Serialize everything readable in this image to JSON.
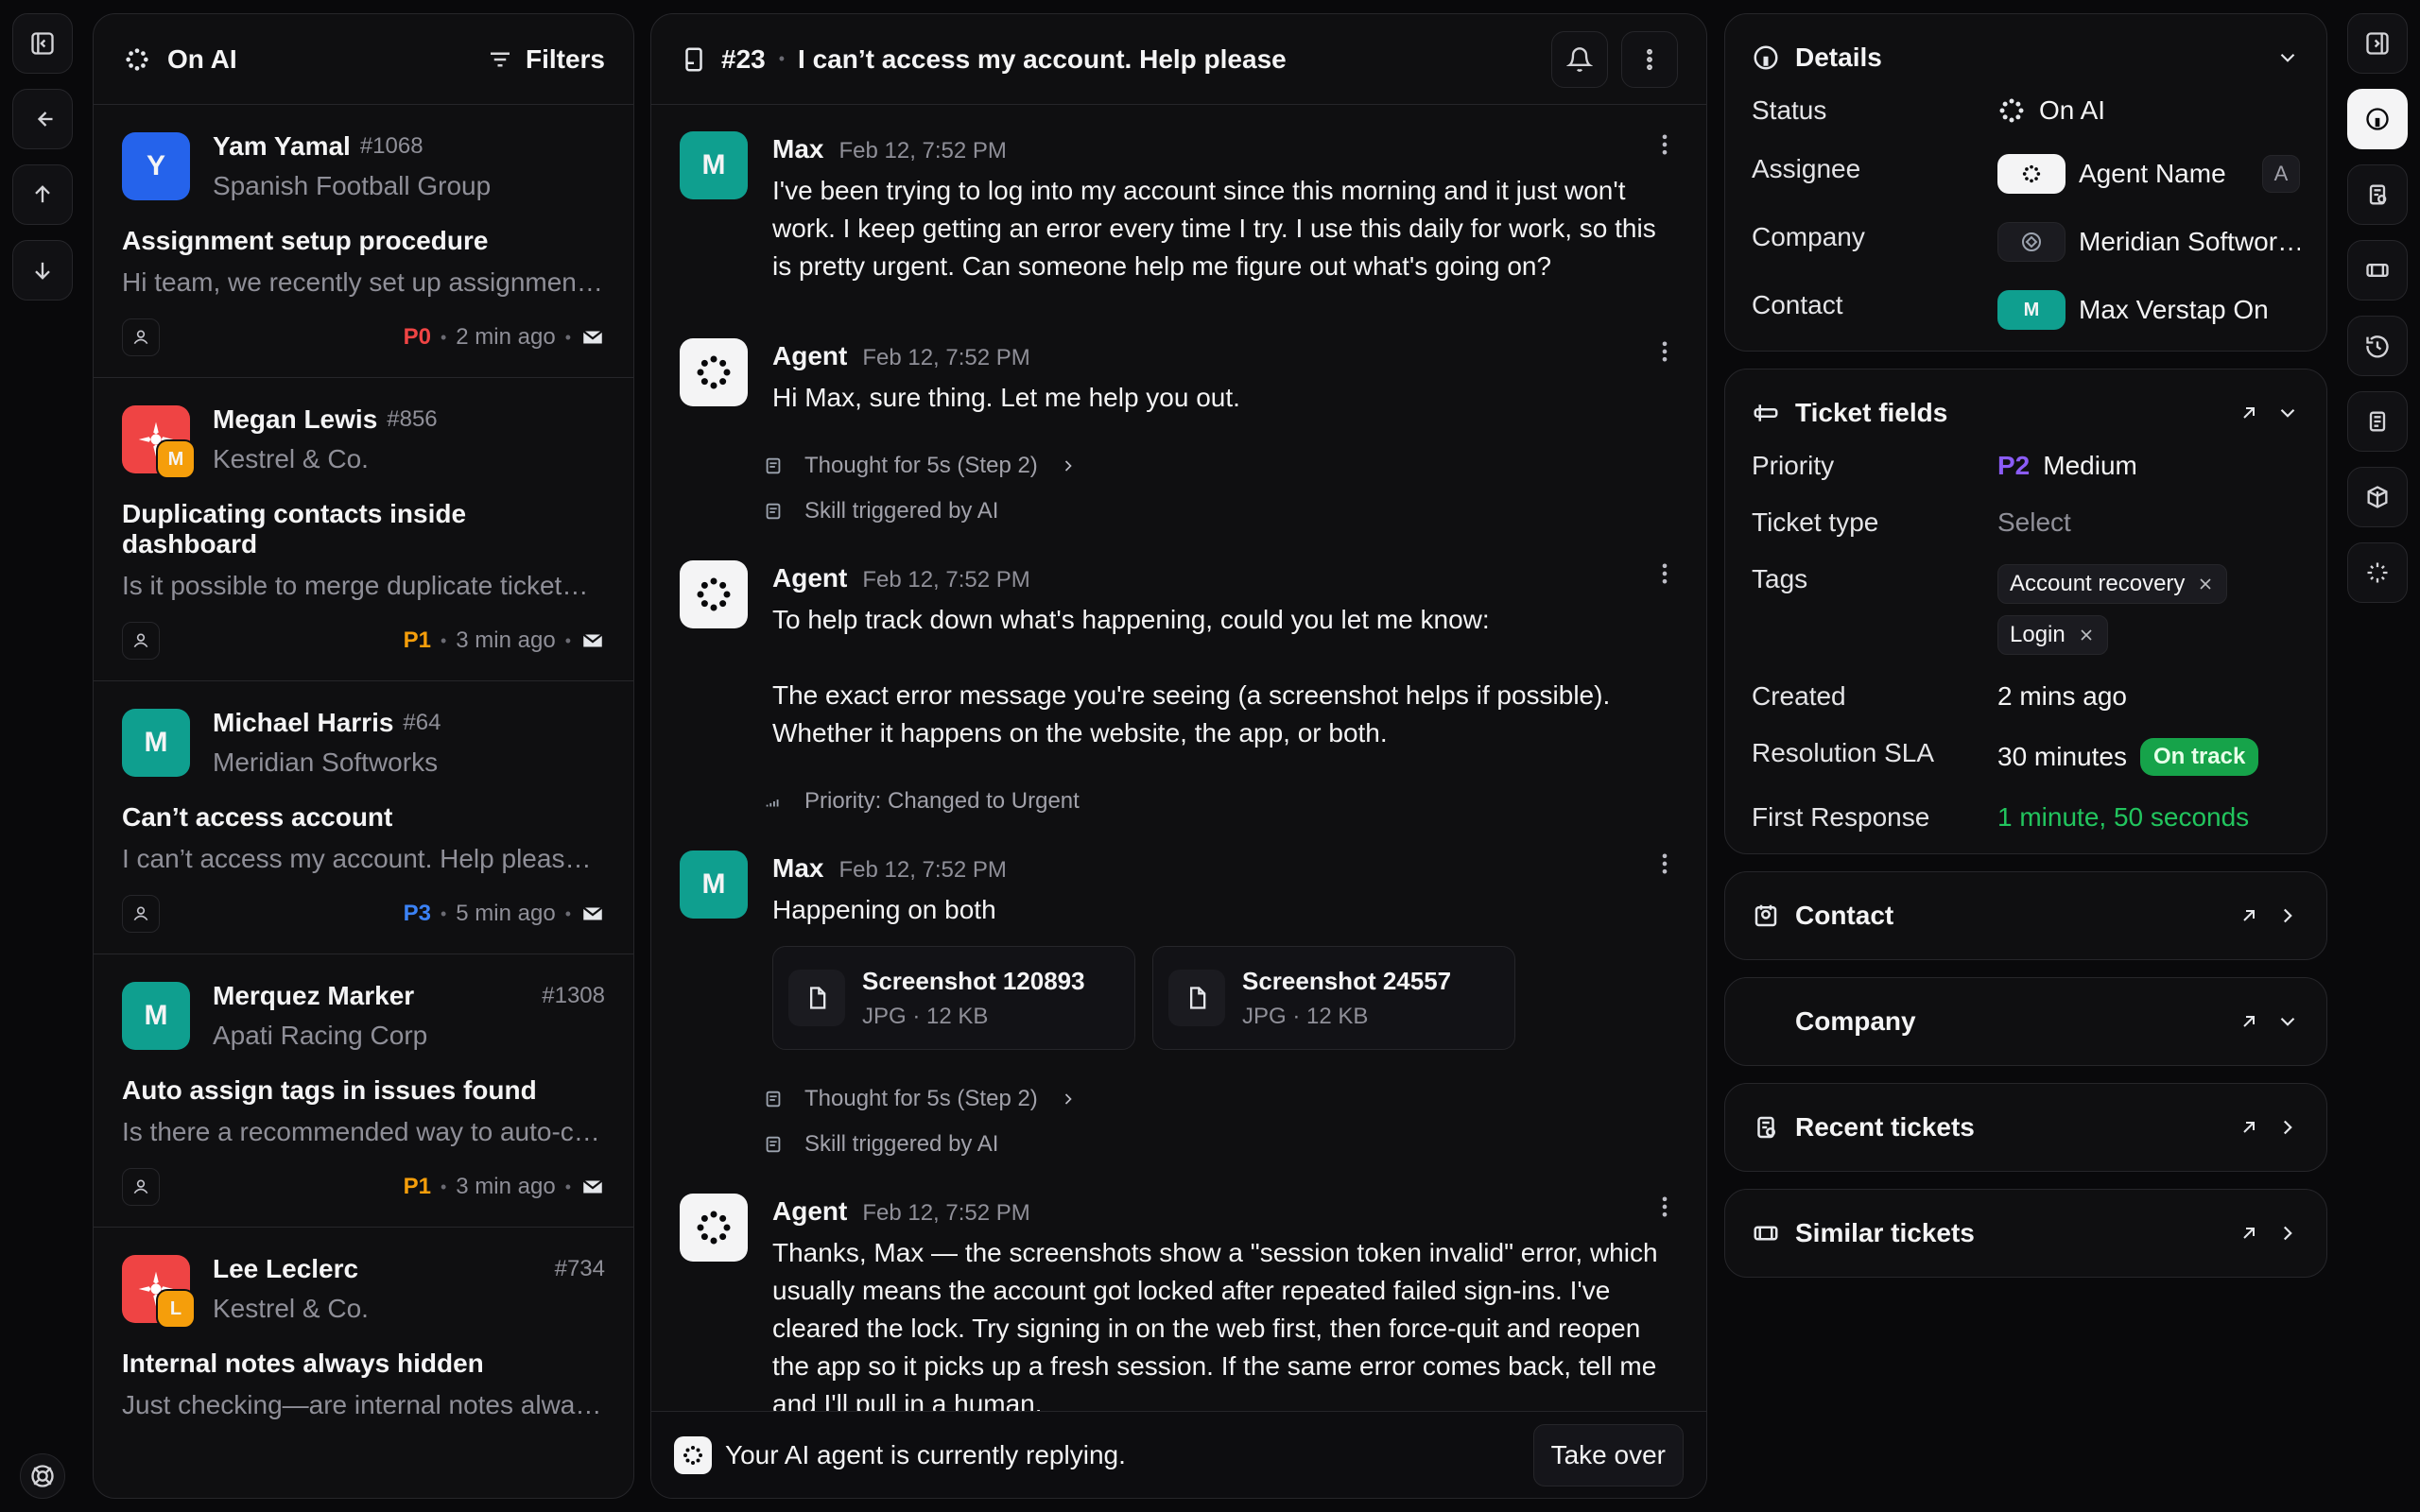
{
  "left_rail": {
    "icons": [
      "sidebar-toggle-icon",
      "arrow-left-icon",
      "arrow-up-icon",
      "arrow-down-icon",
      "help-icon"
    ]
  },
  "list": {
    "header_title": "On AI",
    "filters_label": "Filters",
    "items": [
      {
        "name": "Yam Yamal",
        "id": "#1068",
        "company": "Spanish Football Group",
        "title": "Assignment setup procedure",
        "snippet": "Hi team, we recently set up assignmen…",
        "priority": "P0",
        "time": "2 min ago",
        "avatar_letter": "Y",
        "avatar_color": "#2563eb",
        "priority_color": "#ef4444"
      },
      {
        "name": "Megan Lewis",
        "id": "#856",
        "company": "Kestrel & Co.",
        "title": "Duplicating contacts inside dashboard",
        "snippet": "Is it possible to merge duplicate ticket…",
        "priority": "P1",
        "time": "3 min ago",
        "avatar_letter": "M",
        "avatar_color": "#ef4444",
        "priority_color": "#f59e0b"
      },
      {
        "name": "Michael Harris",
        "id": "#64",
        "company": "Meridian Softworks",
        "title": "Can’t access account",
        "snippet": "I can’t access my account. Help please…",
        "priority": "P3",
        "time": "5 min ago",
        "avatar_letter": "M",
        "avatar_color": "#0f9f8f",
        "priority_color": "#3b82f6"
      },
      {
        "name": "Merquez Marker",
        "id": "#1308",
        "company": "Apati Racing Corp",
        "title": "Auto assign tags in issues found",
        "snippet": "Is there a recommended way to auto-c…",
        "priority": "P1",
        "time": "3 min ago",
        "avatar_letter": "M",
        "avatar_color": "#0f9f8f",
        "priority_color": "#f59e0b"
      },
      {
        "name": "Lee Leclerc",
        "id": "#734",
        "company": "Kestrel & Co.",
        "title": "Internal notes always hidden",
        "snippet": "Just checking—are internal notes alwa…",
        "avatar_letter": "L",
        "avatar_color": "#ef4444"
      }
    ]
  },
  "conversation": {
    "ticket_id": "#23",
    "subject": "I can’t access my account. Help please",
    "messages": [
      {
        "author": "Max",
        "time": "Feb 12, 7:52 PM",
        "text": "I've been trying to log into my account since this morning and it just won't work. I keep getting an error every time I try. I use this daily for work, so this is pretty urgent. Can someone help me figure out what's going on?"
      },
      {
        "author": "Agent",
        "time": "Feb 12, 7:52 PM",
        "text": "Hi Max, sure thing. Let me help you out."
      },
      {
        "author": "Agent",
        "time": "Feb 12, 7:52 PM",
        "text_lines": [
          "To help track down what's happening, could you let me know:",
          "",
          "The exact error message you're seeing (a screenshot helps if possible).",
          "Whether it happens on the website, the app, or both."
        ]
      },
      {
        "author": "Max",
        "time": "Feb 12, 7:52 PM",
        "text": "Happening on both",
        "attachments": [
          {
            "name": "Screenshot 120893",
            "meta": "JPG · 12 KB"
          },
          {
            "name": "Screenshot 24557",
            "meta": "JPG · 12 KB"
          }
        ]
      },
      {
        "author": "Agent",
        "time": "Feb 12, 7:52 PM",
        "text": "Thanks, Max — the screenshots show a \"session token invalid\" error, which usually means the account got locked after repeated failed sign-ins. I've cleared the lock. Try signing in on the web first, then force-quit and reopen the app so it picks up a fresh session. If the same error comes back, tell me and I'll pull in a human."
      }
    ],
    "system": {
      "thought": "Thought for 5s (Step 2)",
      "skill": "Skill triggered by AI",
      "priority_change": "Priority: Changed to Urgent"
    },
    "footer": {
      "status": "Your AI agent is currently replying.",
      "take_over": "Take over"
    }
  },
  "details": {
    "title": "Details",
    "rows": [
      {
        "key": "Status",
        "value": "On AI"
      },
      {
        "key": "Assignee",
        "value": "Agent Name",
        "badge": "A"
      },
      {
        "key": "Company",
        "value": "Meridian Softwor…"
      },
      {
        "key": "Contact",
        "value": "Max Verstap On"
      }
    ]
  },
  "ticket_fields": {
    "title": "Ticket fields",
    "priority_code": "P2",
    "priority_label": "Medium",
    "ticket_type_label": "Ticket type",
    "ticket_type_value": "Select",
    "tags_label": "Tags",
    "tags": [
      "Account recovery",
      "Login"
    ],
    "created_label": "Created",
    "created_value": "2 mins ago",
    "sla_label": "Resolution SLA",
    "sla_value": "30 minutes",
    "sla_status": "On track",
    "first_response_label": "First Response",
    "first_response_value": "1 minute, 50 seconds",
    "priority_label_key": "Priority"
  },
  "sections": [
    {
      "title": "Contact"
    },
    {
      "title": "Company"
    },
    {
      "title": "Recent tickets"
    },
    {
      "title": "Similar tickets"
    }
  ],
  "right_rail": {
    "icons": [
      "collapse-right-icon",
      "info-icon",
      "recent-tickets-icon",
      "ticket-icon",
      "history-icon",
      "document-icon",
      "box-icon",
      "sparkles-icon"
    ]
  },
  "colors": {
    "accent": "#8b5cf6",
    "green": "#22c55e",
    "red": "#ef4444",
    "orange": "#f59e0b",
    "blue": "#3b82f6"
  }
}
